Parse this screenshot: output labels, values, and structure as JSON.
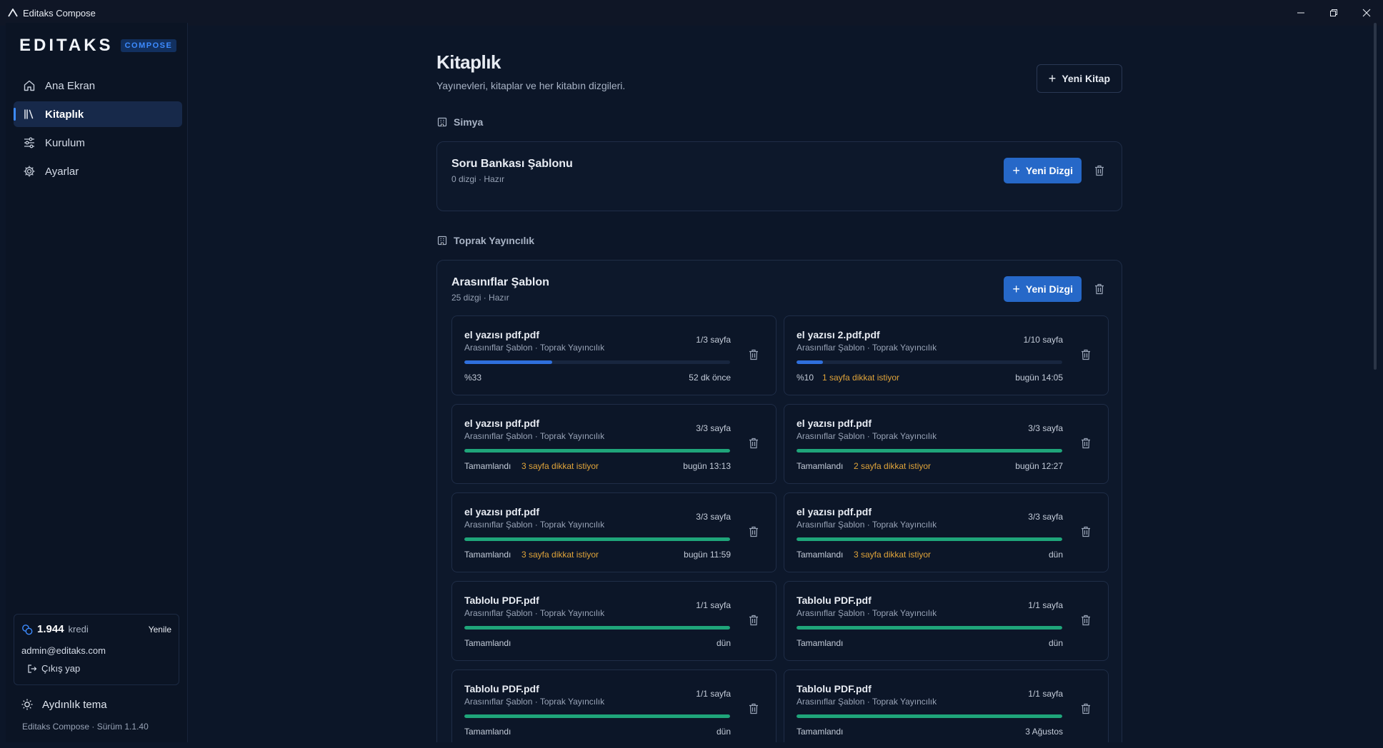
{
  "window": {
    "title": "Editaks Compose"
  },
  "brand": {
    "name": "EDITAKS",
    "badge": "COMPOSE"
  },
  "nav": {
    "items": [
      {
        "label": "Ana Ekran",
        "icon": "home-icon",
        "active": false
      },
      {
        "label": "Kitaplık",
        "icon": "library-icon",
        "active": true
      },
      {
        "label": "Kurulum",
        "icon": "sliders-icon",
        "active": false
      },
      {
        "label": "Ayarlar",
        "icon": "gear-icon",
        "active": false
      }
    ]
  },
  "account": {
    "credits": "1.944",
    "credits_unit": "kredi",
    "refresh_label": "Yenile",
    "email": "admin@editaks.com",
    "logout_label": "Çıkış yap"
  },
  "theme_toggle": "Aydınlık tema",
  "version": "Editaks Compose · Sürüm 1.1.40",
  "page": {
    "title": "Kitaplık",
    "subtitle": "Yayınevleri, kitaplar ve her kitabın dizgileri.",
    "new_book_label": "Yeni Kitap"
  },
  "colors": {
    "accent": "#2668c8",
    "progress_done": "#1fa57a",
    "progress_active": "#2f6fdc",
    "warning": "#e0a43a"
  },
  "publishers": [
    {
      "name": "Simya",
      "books": [
        {
          "title": "Soru Bankası Şablonu",
          "meta": "0 dizgi · Hazır",
          "new_label": "Yeni Dizgi",
          "docs": []
        }
      ]
    },
    {
      "name": "Toprak Yayıncılık",
      "books": [
        {
          "title": "Arasınıflar Şablon",
          "meta": "25 dizgi · Hazır",
          "new_label": "Yeni Dizgi",
          "docs": [
            {
              "name": "el yazısı pdf.pdf",
              "sub": "Arasınıflar Şablon · Toprak Yayıncılık",
              "pages": "1/3 sayfa",
              "progress": 0.33,
              "status": "%33",
              "warning": "",
              "time": "52 dk önce",
              "done": false
            },
            {
              "name": "el yazısı 2.pdf.pdf",
              "sub": "Arasınıflar Şablon · Toprak Yayıncılık",
              "pages": "1/10 sayfa",
              "progress": 0.1,
              "status": "%10",
              "warning": "1 sayfa dikkat istiyor",
              "time": "bugün 14:05",
              "done": false
            },
            {
              "name": "el yazısı pdf.pdf",
              "sub": "Arasınıflar Şablon · Toprak Yayıncılık",
              "pages": "3/3 sayfa",
              "progress": 1,
              "status": "Tamamlandı",
              "warning": "3 sayfa dikkat istiyor",
              "time": "bugün 13:13",
              "done": true
            },
            {
              "name": "el yazısı pdf.pdf",
              "sub": "Arasınıflar Şablon · Toprak Yayıncılık",
              "pages": "3/3 sayfa",
              "progress": 1,
              "status": "Tamamlandı",
              "warning": "2 sayfa dikkat istiyor",
              "time": "bugün 12:27",
              "done": true
            },
            {
              "name": "el yazısı pdf.pdf",
              "sub": "Arasınıflar Şablon · Toprak Yayıncılık",
              "pages": "3/3 sayfa",
              "progress": 1,
              "status": "Tamamlandı",
              "warning": "3 sayfa dikkat istiyor",
              "time": "bugün 11:59",
              "done": true
            },
            {
              "name": "el yazısı pdf.pdf",
              "sub": "Arasınıflar Şablon · Toprak Yayıncılık",
              "pages": "3/3 sayfa",
              "progress": 1,
              "status": "Tamamlandı",
              "warning": "3 sayfa dikkat istiyor",
              "time": "dün",
              "done": true
            },
            {
              "name": "Tablolu PDF.pdf",
              "sub": "Arasınıflar Şablon · Toprak Yayıncılık",
              "pages": "1/1 sayfa",
              "progress": 1,
              "status": "Tamamlandı",
              "warning": "",
              "time": "dün",
              "done": true
            },
            {
              "name": "Tablolu PDF.pdf",
              "sub": "Arasınıflar Şablon · Toprak Yayıncılık",
              "pages": "1/1 sayfa",
              "progress": 1,
              "status": "Tamamlandı",
              "warning": "",
              "time": "dün",
              "done": true
            },
            {
              "name": "Tablolu PDF.pdf",
              "sub": "Arasınıflar Şablon · Toprak Yayıncılık",
              "pages": "1/1 sayfa",
              "progress": 1,
              "status": "Tamamlandı",
              "warning": "",
              "time": "dün",
              "done": true
            },
            {
              "name": "Tablolu PDF.pdf",
              "sub": "Arasınıflar Şablon · Toprak Yayıncılık",
              "pages": "1/1 sayfa",
              "progress": 1,
              "status": "Tamamlandı",
              "warning": "",
              "time": "3 Ağustos",
              "done": true
            }
          ]
        }
      ]
    }
  ]
}
